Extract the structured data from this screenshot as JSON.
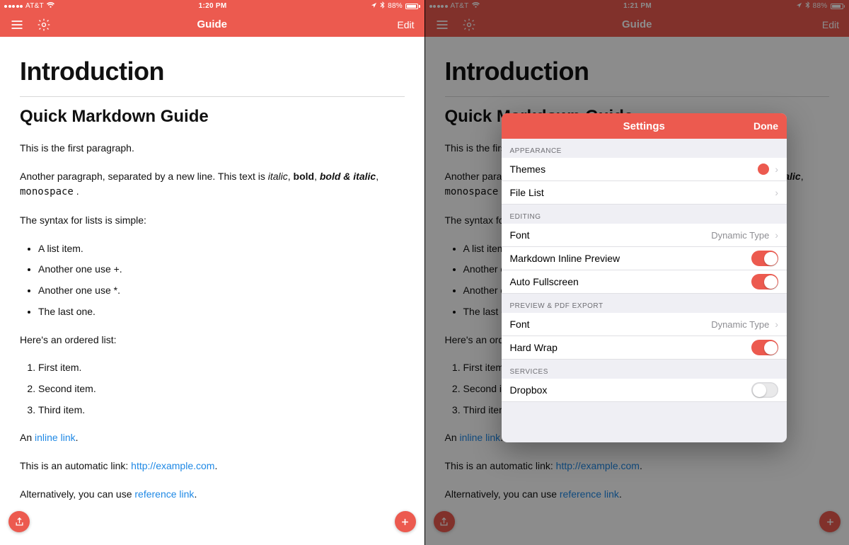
{
  "left": {
    "status": {
      "carrier": "AT&T",
      "time": "1:20 PM",
      "battery": "88%"
    },
    "nav": {
      "title": "Guide",
      "edit": "Edit"
    },
    "doc": {
      "h1": "Introduction",
      "h2": "Quick Markdown Guide",
      "p1": "This is the first paragraph.",
      "p2a": "Another paragraph, separated by a new line. This text is ",
      "italic": "italic",
      "sep1": ", ",
      "bold": "bold",
      "sep2": ", ",
      "bolditalic": "bold & italic",
      "sep3": ", ",
      "mono": "monospace",
      "sep4": " .",
      "p3": "The syntax for lists is simple:",
      "ul": [
        "A list item.",
        "Another one use +.",
        "Another one use *.",
        "The last one."
      ],
      "p4": "Here's an ordered list:",
      "ol": [
        "First item.",
        "Second item.",
        "Third item."
      ],
      "p5a": "An ",
      "p5link": "inline link",
      "p5b": ".",
      "p6a": "This is an automatic link: ",
      "p6link": "http://example.com",
      "p6b": ".",
      "p7a": "Alternatively, you can use ",
      "p7link": "reference link",
      "p7b": "."
    }
  },
  "right": {
    "status": {
      "carrier": "AT&T",
      "time": "1:21 PM",
      "battery": "88%"
    },
    "nav": {
      "title": "Guide",
      "edit": "Edit"
    },
    "modal": {
      "title": "Settings",
      "done": "Done",
      "sections": {
        "appearance": {
          "header": "APPEARANCE",
          "themes": {
            "label": "Themes",
            "swatch_color": "#ec5a4f"
          },
          "file_list": {
            "label": "File List"
          }
        },
        "editing": {
          "header": "EDITING",
          "font": {
            "label": "Font",
            "value": "Dynamic Type"
          },
          "inline": {
            "label": "Markdown Inline Preview",
            "on": true
          },
          "autofs": {
            "label": "Auto Fullscreen",
            "on": true
          }
        },
        "preview": {
          "header": "PREVIEW & PDF EXPORT",
          "font": {
            "label": "Font",
            "value": "Dynamic Type"
          },
          "hardwrap": {
            "label": "Hard Wrap",
            "on": true
          }
        },
        "services": {
          "header": "SERVICES",
          "dropbox": {
            "label": "Dropbox",
            "on": false
          }
        }
      }
    }
  }
}
